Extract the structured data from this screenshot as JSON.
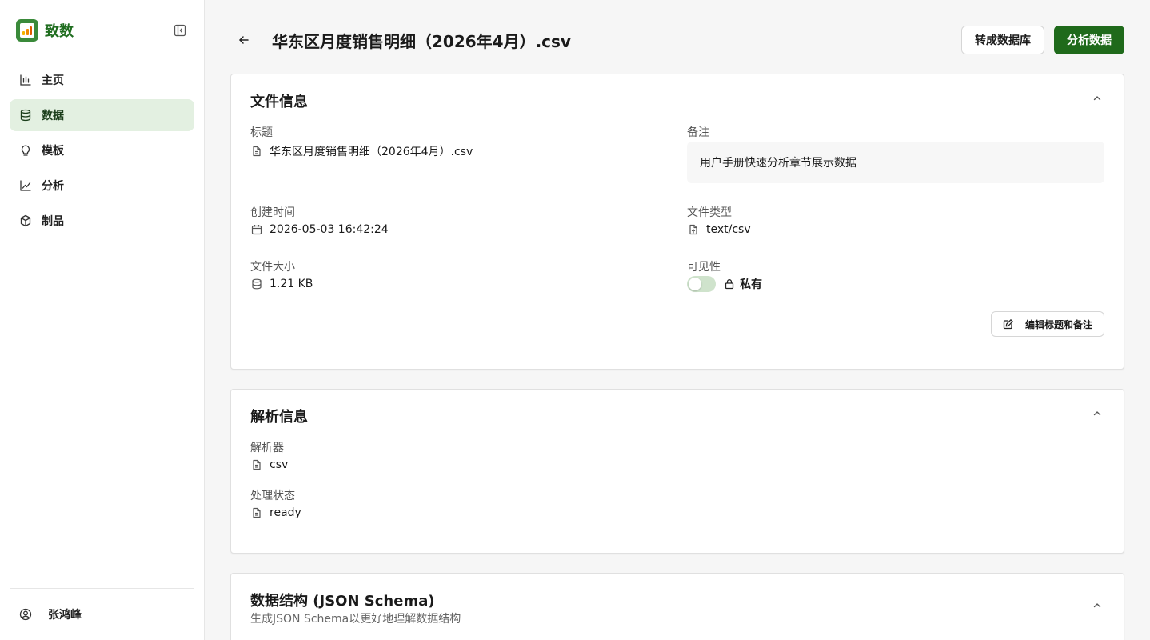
{
  "app": {
    "name": "致数"
  },
  "sidebar": {
    "items": [
      {
        "label": "主页",
        "icon": "bar-chart-icon"
      },
      {
        "label": "数据",
        "icon": "database-icon",
        "active": true
      },
      {
        "label": "模板",
        "icon": "lightbulb-icon"
      },
      {
        "label": "分析",
        "icon": "line-chart-icon"
      },
      {
        "label": "制品",
        "icon": "box-icon"
      }
    ],
    "user": {
      "name": "张鸿峰"
    }
  },
  "header": {
    "title": "华东区月度销售明细（2026年4月）.csv",
    "convert_label": "转成数据库",
    "analyze_label": "分析数据"
  },
  "file_info": {
    "section_title": "文件信息",
    "title_label": "标题",
    "title_value": "华东区月度销售明细（2026年4月）.csv",
    "note_label": "备注",
    "note_value": "用户手册快速分析章节展示数据",
    "created_label": "创建时间",
    "created_value": "2026-05-03 16:42:24",
    "type_label": "文件类型",
    "type_value": "text/csv",
    "size_label": "文件大小",
    "size_value": "1.21 KB",
    "visibility_label": "可见性",
    "visibility_value": "私有",
    "edit_label": "编辑标题和备注"
  },
  "parse_info": {
    "section_title": "解析信息",
    "parser_label": "解析器",
    "parser_value": "csv",
    "status_label": "处理状态",
    "status_value": "ready"
  },
  "schema": {
    "section_title": "数据结构 (JSON Schema)",
    "subtitle": "生成JSON Schema以更好地理解数据结构"
  },
  "colors": {
    "primary": "#1f6a1b",
    "active_bg": "#e3f0e1",
    "brand": "#3a8a3a"
  }
}
